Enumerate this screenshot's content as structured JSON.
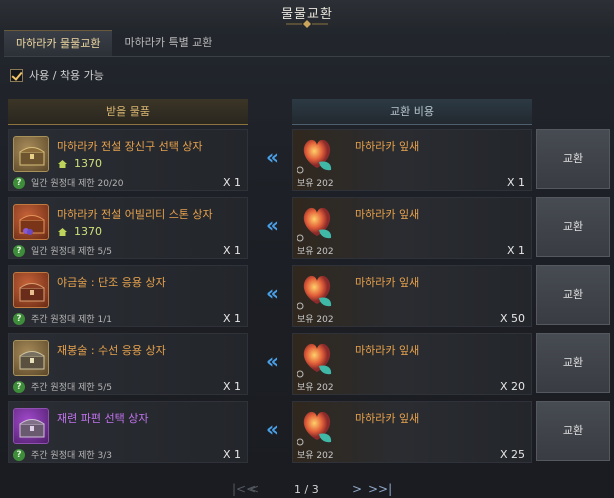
{
  "window": {
    "title": "물물교환"
  },
  "tabs": [
    {
      "label": "마하라카 물물교환",
      "active": true
    },
    {
      "label": "마하라카 특별 교환",
      "active": false
    }
  ],
  "filter": {
    "label": "사용 / 착용 가능",
    "checked": true
  },
  "columns": {
    "receive": "받을 물품",
    "cost": "교환 비용"
  },
  "rows": [
    {
      "item_name": "마하라카 전설 장신구 선택 상자",
      "item_icon": "chest-icon",
      "rarity": "legendary",
      "price": "1370",
      "limit": "일간 원정대 제한 20/20",
      "receive_qty": "X 1",
      "cost_name": "마하라카 잎새",
      "cost_hold": "보유 202",
      "cost_qty": "X 1",
      "button": "교환"
    },
    {
      "item_name": "마하라카 전설 어빌리티 스톤 상자",
      "item_icon": "chest-icon",
      "rarity": "legendary",
      "price": "1370",
      "limit": "일간 원정대 제한 5/5",
      "receive_qty": "X 1",
      "cost_name": "마하라카 잎새",
      "cost_hold": "보유 202",
      "cost_qty": "X 1",
      "button": "교환"
    },
    {
      "item_name": "야금술 : 단조 응용 상자",
      "item_icon": "chest-icon",
      "rarity": "legendary",
      "price": "",
      "limit": "주간 원정대 제한 1/1",
      "receive_qty": "X 1",
      "cost_name": "마하라카 잎새",
      "cost_hold": "보유 202",
      "cost_qty": "X 50",
      "button": "교환"
    },
    {
      "item_name": "재봉술 : 수선 응용 상자",
      "item_icon": "chest-icon",
      "rarity": "legendary",
      "price": "",
      "limit": "주간 원정대 제한 5/5",
      "receive_qty": "X 1",
      "cost_name": "마하라카 잎새",
      "cost_hold": "보유 202",
      "cost_qty": "X 20",
      "button": "교환"
    },
    {
      "item_name": "재련 파편 선택 상자",
      "item_icon": "chest-icon",
      "rarity": "epic",
      "price": "",
      "limit": "주간 원정대 제한 3/3",
      "receive_qty": "X 1",
      "cost_name": "마하라카 잎새",
      "cost_hold": "보유 202",
      "cost_qty": "X 25",
      "button": "교환"
    }
  ],
  "pagination": {
    "text": "1 / 3",
    "first": "|<<",
    "prev": "<",
    "next": ">",
    "last": ">>|"
  },
  "colors": {
    "legendary": "#e7a24d",
    "epic": "#c273ef",
    "accent_blue": "#4aa0e8",
    "price_green": "#cfe07a"
  }
}
